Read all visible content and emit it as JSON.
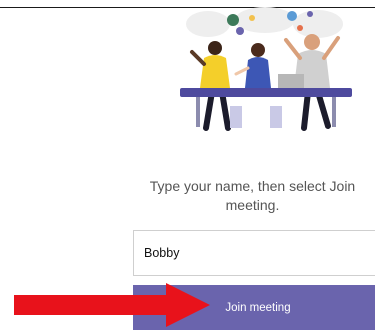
{
  "join": {
    "instruction": "Type your name, then select Join meeting.",
    "name_value": "Bobby",
    "button_label": "Join meeting"
  },
  "colors": {
    "button_bg": "#6a64ad",
    "arrow": "#e8121b",
    "table": "#4e4a9e"
  },
  "icons": {
    "illustration": "people-meeting-illustration",
    "annotation": "red-arrow-right"
  }
}
